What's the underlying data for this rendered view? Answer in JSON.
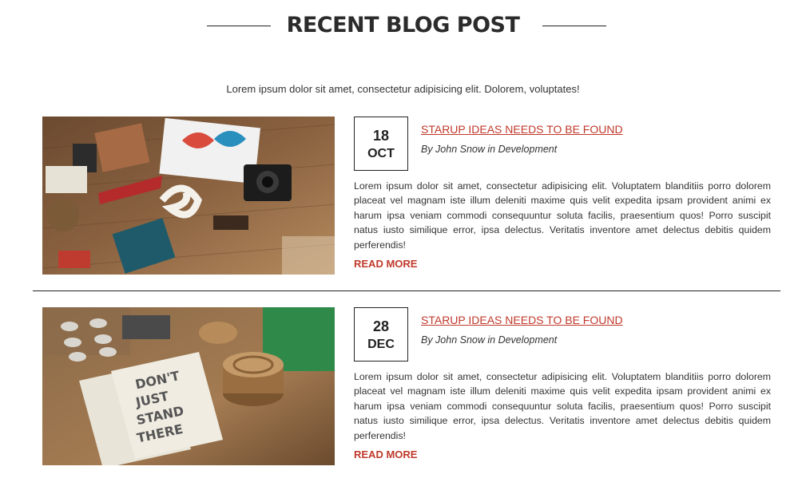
{
  "header": {
    "title": "RECENT BLOG POST",
    "intro": "Lorem ipsum dolor sit amet, consectetur adipisicing elit. Dolorem, voluptates!"
  },
  "posts": [
    {
      "day": "18",
      "month": "OCT",
      "title": "STARUP IDEAS NEEDS TO BE FOUND",
      "meta": "By John Snow in Development",
      "body": "Lorem ipsum dolor sit amet, consectetur adipisicing elit. Voluptatem blanditiis porro dolorem placeat vel magnam iste illum deleniti maxime quis velit expedita ipsam provident animi ex harum ipsa veniam commodi consequuntur soluta facilis, praesentium quos! Porro suscipit natus iusto similique error, ipsa delectus. Veritatis inventore amet delectus debitis quidem perferendis!",
      "read_more": "READ MORE"
    },
    {
      "day": "28",
      "month": "DEC",
      "title": "STARUP IDEAS NEEDS TO BE FOUND",
      "meta": "By John Snow in Development",
      "body": "Lorem ipsum dolor sit amet, consectetur adipisicing elit. Voluptatem blanditiis porro dolorem placeat vel magnam iste illum deleniti maxime quis velit expedita ipsam provident animi ex harum ipsa veniam commodi consequuntur soluta facilis, praesentium quos! Porro suscipit natus iusto similique error, ipsa delectus. Veritatis inventore amet delectus debitis quidem perferendis!",
      "read_more": "READ MORE"
    }
  ],
  "colors": {
    "accent": "#c0392b",
    "text": "#333333",
    "heading": "#2b2b2b"
  },
  "images": {
    "post1": "flatlay-desk-image",
    "post2": "dont-just-stand-there-image"
  }
}
